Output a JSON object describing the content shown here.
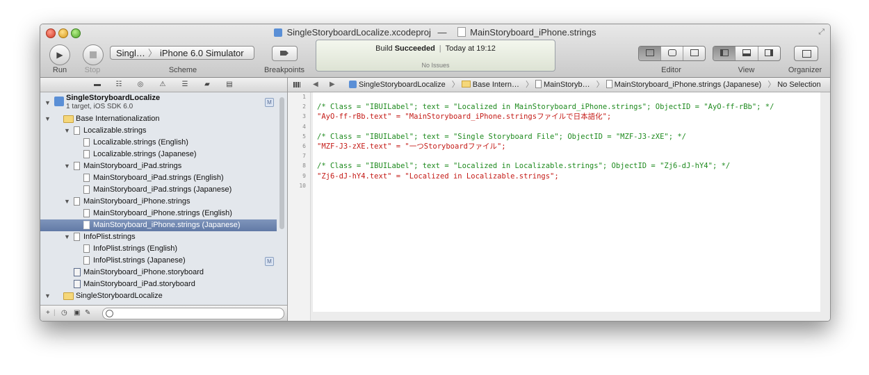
{
  "window": {
    "title_project": "SingleStoryboardLocalize.xcodeproj",
    "title_sep": "—",
    "title_file": "MainStoryboard_iPhone.strings"
  },
  "toolbar": {
    "run_label": "Run",
    "stop_label": "Stop",
    "scheme_target": "Singl…",
    "scheme_sep": "〉",
    "scheme_device": "iPhone 6.0 Simulator",
    "scheme_label": "Scheme",
    "breakpoints_label": "Breakpoints",
    "editor_label": "Editor",
    "view_label": "View",
    "organizer_label": "Organizer"
  },
  "activity": {
    "build": "Build",
    "status": "Succeeded",
    "time": "Today at 19:12",
    "issues": "No Issues"
  },
  "navigator": {
    "project_name": "SingleStoryboardLocalize",
    "project_sub": "1 target, iOS SDK 6.0",
    "project_badge": "M",
    "items": [
      {
        "label": "Base Internationalization",
        "type": "folder",
        "level": 1,
        "open": true
      },
      {
        "label": "Localizable.strings",
        "type": "file",
        "level": 2,
        "open": true
      },
      {
        "label": "Localizable.strings (English)",
        "type": "file",
        "level": 3
      },
      {
        "label": "Localizable.strings (Japanese)",
        "type": "file",
        "level": 3
      },
      {
        "label": "MainStoryboard_iPad.strings",
        "type": "file",
        "level": 2,
        "open": true
      },
      {
        "label": "MainStoryboard_iPad.strings (English)",
        "type": "file",
        "level": 3
      },
      {
        "label": "MainStoryboard_iPad.strings (Japanese)",
        "type": "file",
        "level": 3
      },
      {
        "label": "MainStoryboard_iPhone.strings",
        "type": "file",
        "level": 2,
        "open": true
      },
      {
        "label": "MainStoryboard_iPhone.strings (English)",
        "type": "file",
        "level": 3
      },
      {
        "label": "MainStoryboard_iPhone.strings (Japanese)",
        "type": "file",
        "level": 3,
        "selected": true
      },
      {
        "label": "InfoPlist.strings",
        "type": "file",
        "level": 2,
        "open": true
      },
      {
        "label": "InfoPlist.strings (English)",
        "type": "file",
        "level": 3
      },
      {
        "label": "InfoPlist.strings (Japanese)",
        "type": "file",
        "level": 3,
        "badge": "M"
      },
      {
        "label": "MainStoryboard_iPhone.storyboard",
        "type": "storyboard",
        "level": 2
      },
      {
        "label": "MainStoryboard_iPad.storyboard",
        "type": "storyboard",
        "level": 2
      },
      {
        "label": "SingleStoryboardLocalize",
        "type": "folder",
        "level": 1,
        "open": true
      }
    ]
  },
  "jumpbar": {
    "crumbs": [
      {
        "label": "SingleStoryboardLocalize",
        "icon": "project"
      },
      {
        "label": "Base Intern…",
        "icon": "folder"
      },
      {
        "label": "MainStoryb…",
        "icon": "doc"
      },
      {
        "label": "MainStoryboard_iPhone.strings (Japanese)",
        "icon": "doc"
      },
      {
        "label": "No Selection",
        "icon": ""
      }
    ],
    "sep": "〉"
  },
  "editor": {
    "line_numbers": [
      "1",
      "2",
      "3",
      "4",
      "5",
      "6",
      "7",
      "8",
      "9",
      "10"
    ],
    "lines": [
      {
        "kind": "blank",
        "text": ""
      },
      {
        "kind": "comment",
        "text": "/* Class = \"IBUILabel\"; text = \"Localized in MainStoryboard_iPhone.strings\"; ObjectID = \"AyO-ff-rBb\"; */"
      },
      {
        "kind": "string",
        "text": "\"AyO-ff-rBb.text\" = \"MainStoryboard_iPhone.stringsファイルで日本語化\";"
      },
      {
        "kind": "blank",
        "text": ""
      },
      {
        "kind": "comment",
        "text": "/* Class = \"IBUILabel\"; text = \"Single Storyboard File\"; ObjectID = \"MZF-J3-zXE\"; */"
      },
      {
        "kind": "string",
        "text": "\"MZF-J3-zXE.text\" = \"一つStoryboardファイル\";"
      },
      {
        "kind": "blank",
        "text": ""
      },
      {
        "kind": "comment",
        "text": "/* Class = \"IBUILabel\"; text = \"Localized in Localizable.strings\"; ObjectID = \"Zj6-dJ-hY4\"; */"
      },
      {
        "kind": "string",
        "text": "\"Zj6-dJ-hY4.text\" = \"Localized in Localizable.strings\";"
      },
      {
        "kind": "blank",
        "text": ""
      }
    ]
  },
  "colors": {
    "comment": "#1e8a1e",
    "string": "#c41a16",
    "selection": "#6d84ae"
  }
}
